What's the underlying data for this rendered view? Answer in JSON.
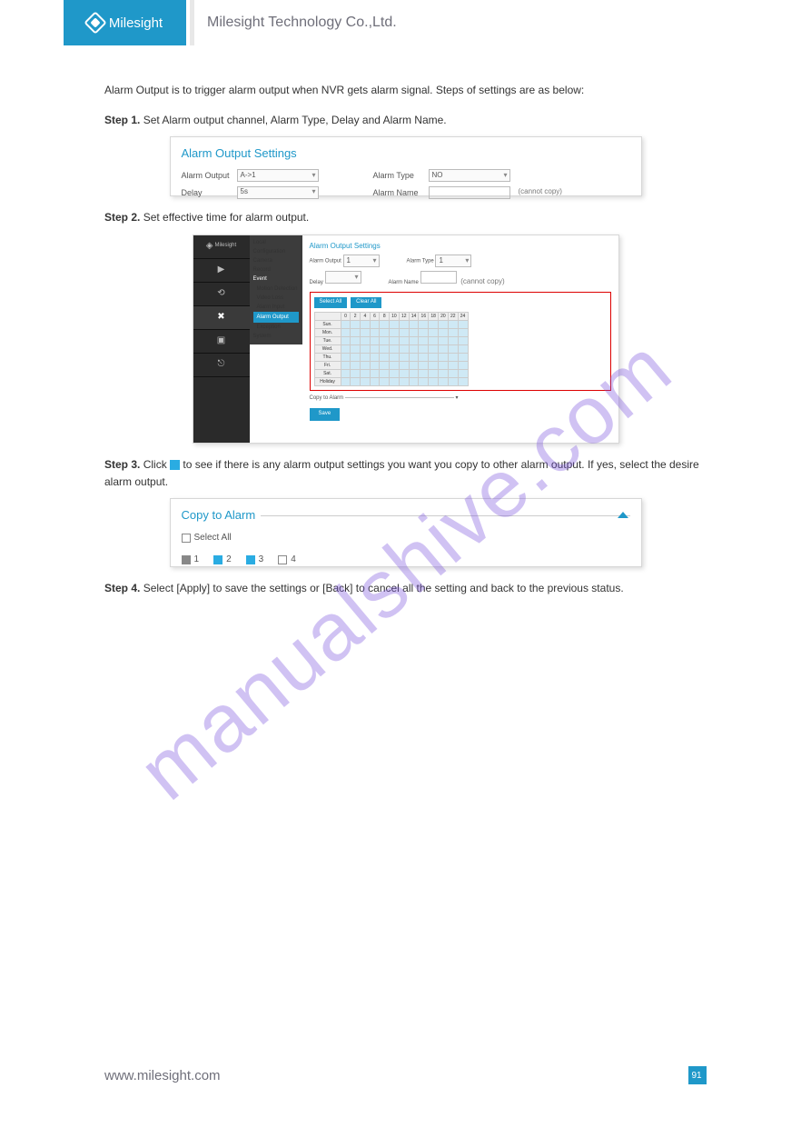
{
  "header": {
    "brand": "Milesight",
    "company": "Milesight Technology Co.,Ltd."
  },
  "intro": "Alarm Output is to trigger alarm output when NVR gets alarm signal. Steps of settings are as below:",
  "steps": {
    "s1": {
      "label": "Step 1.",
      "text": " Set Alarm output channel, Alarm Type, Delay and Alarm Name."
    },
    "s2": {
      "label": "Step 2.",
      "text": " Set effective time for alarm output."
    },
    "s3": {
      "label": "Step 3.",
      "pre": "Click ",
      "post": " to see if there is any alarm output settings you want you copy to other alarm output. If yes, select the desire alarm output."
    },
    "s4": {
      "label": "Step 4.",
      "pre": " Select [Apply] to save the settings or [Back] to cancel all the setting and back to the previous status."
    }
  },
  "panel1": {
    "title": "Alarm Output Settings",
    "f1_label": "Alarm Output",
    "f1_val": "A->1",
    "f2_label": "Alarm Type",
    "f2_val": "NO",
    "f3_label": "Delay",
    "f3_val": "5s",
    "f4_label": "Alarm Name",
    "f4_hint": "(cannot copy)"
  },
  "panel2": {
    "brand": "Milesight",
    "title": "Alarm Output Settings",
    "menu": {
      "local": "Local Configuration",
      "camera": "Camera",
      "record": "Record",
      "event": "Event",
      "md": "Motion Detection",
      "vl": "Video Loss",
      "ai": "Alarm Input",
      "ao": "Alarm Output",
      "ex": "Exception",
      "system": "System"
    },
    "f1_label": "Alarm Output",
    "f1_val": "1",
    "f2_label": "Alarm Type",
    "f2_val": "1",
    "f3_label": "Delay",
    "f4_label": "Alarm Name",
    "f4_hint": "(cannot copy)",
    "btn_select_all": "Select All",
    "btn_clear_all": "Clear All",
    "days": [
      "Sun.",
      "Mon.",
      "Tue.",
      "Wed.",
      "Thu.",
      "Fri.",
      "Sat.",
      "Holiday"
    ],
    "copy": "Copy to Alarm",
    "save": "Save"
  },
  "panel3": {
    "title": "Copy to Alarm",
    "select_all": "Select All",
    "n1": "1",
    "n2": "2",
    "n3": "3",
    "n4": "4"
  },
  "footer": {
    "url": "www.milesight.com",
    "page": "91"
  },
  "watermark": "manualshive.com"
}
